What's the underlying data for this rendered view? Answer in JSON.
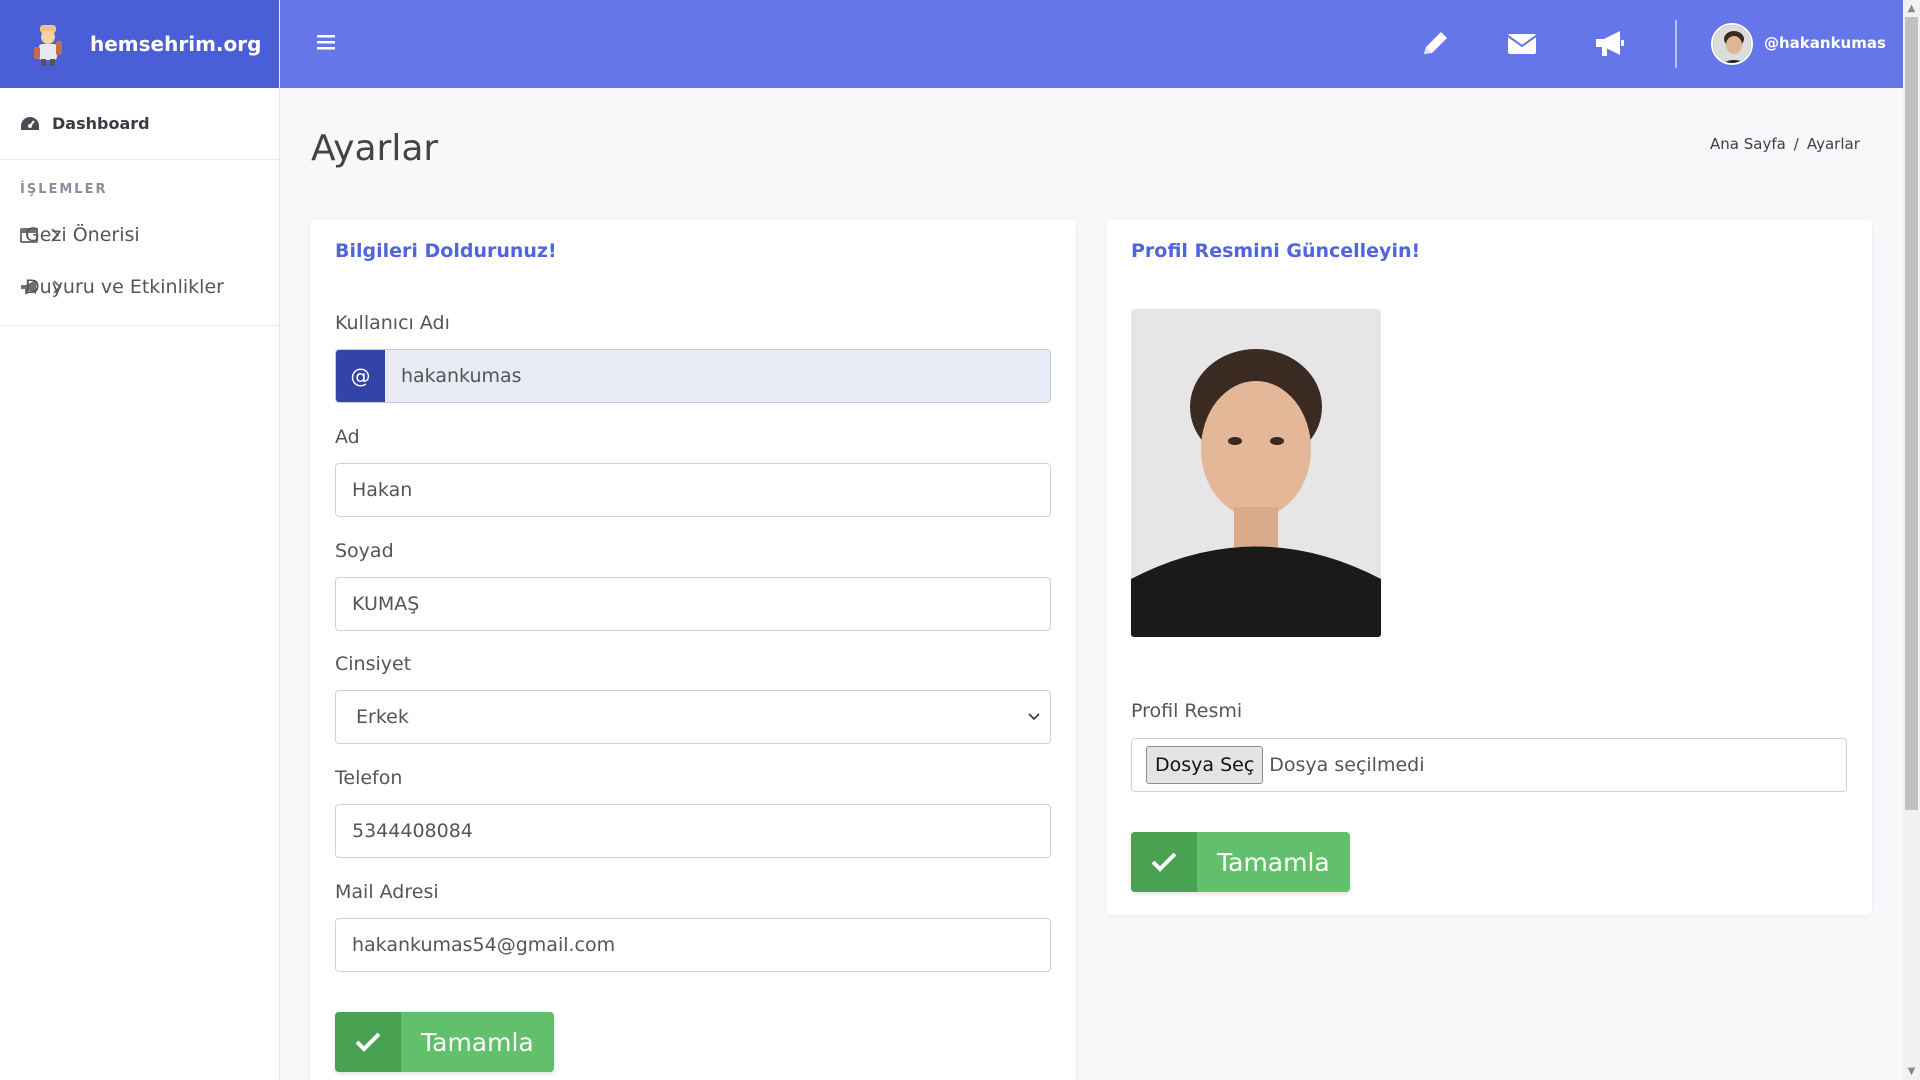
{
  "brand": {
    "name": "hemsehrim.org"
  },
  "sidebar": {
    "dashboard": "Dashboard",
    "heading": "İŞLEMLER",
    "items": [
      {
        "label": "Gezi Önerisi",
        "icon": "calendar-icon"
      },
      {
        "label": "Duyuru ve Etkinlikler",
        "icon": "megaphone-icon"
      }
    ]
  },
  "topbar": {
    "icons": [
      "pencil-icon",
      "envelope-icon",
      "megaphone-icon"
    ],
    "username": "@hakankumas"
  },
  "page": {
    "title": "Ayarlar",
    "breadcrumb": {
      "home": "Ana Sayfa",
      "separator": "/",
      "current": "Ayarlar"
    }
  },
  "info_form": {
    "title": "Bilgileri Doldurunuz!",
    "username_label": "Kullanıcı Adı",
    "username_prefix": "@",
    "username_value": "hakankumas",
    "first_name_label": "Ad",
    "first_name_value": "Hakan",
    "last_name_label": "Soyad",
    "last_name_value": "KUMAŞ",
    "gender_label": "Cinsiyet",
    "gender_value": "Erkek",
    "phone_label": "Telefon",
    "phone_value": "5344408084",
    "email_label": "Mail Adresi",
    "email_value": "hakankumas54@gmail.com",
    "submit_label": "Tamamla"
  },
  "photo_form": {
    "title": "Profil Resmini Güncelleyin!",
    "file_label": "Profil Resmi",
    "file_button": "Dosya Seç",
    "file_status": "Dosya seçilmedi",
    "submit_label": "Tamamla"
  },
  "colors": {
    "topbar": "#6476e8",
    "brand_bg": "#4a5ed8",
    "accent": "#5065dc",
    "success": "#62bf6b",
    "success_dark": "#48a252",
    "addon": "#3344a8"
  }
}
